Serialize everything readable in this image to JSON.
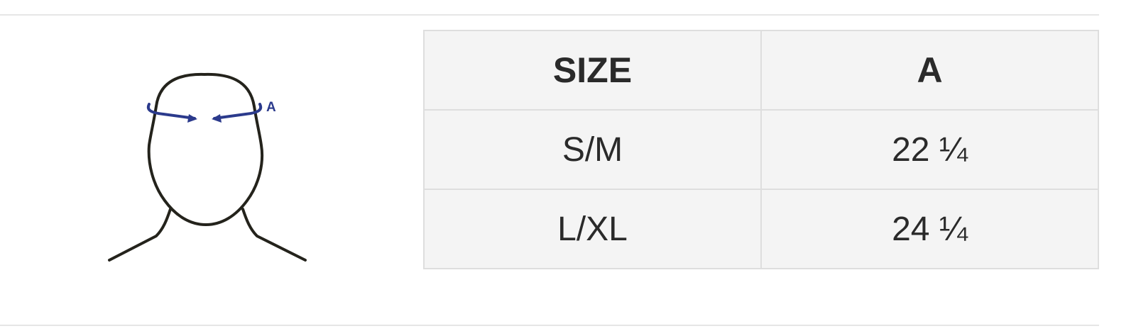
{
  "diagram": {
    "measure_label": "A",
    "arrow_color": "#2b3a8c",
    "outline_color": "#24231c"
  },
  "size_table": {
    "headers": [
      "SIZE",
      "A"
    ],
    "rows": [
      [
        "S/M",
        "22 ¼"
      ],
      [
        "L/XL",
        "24 ¼"
      ]
    ]
  }
}
